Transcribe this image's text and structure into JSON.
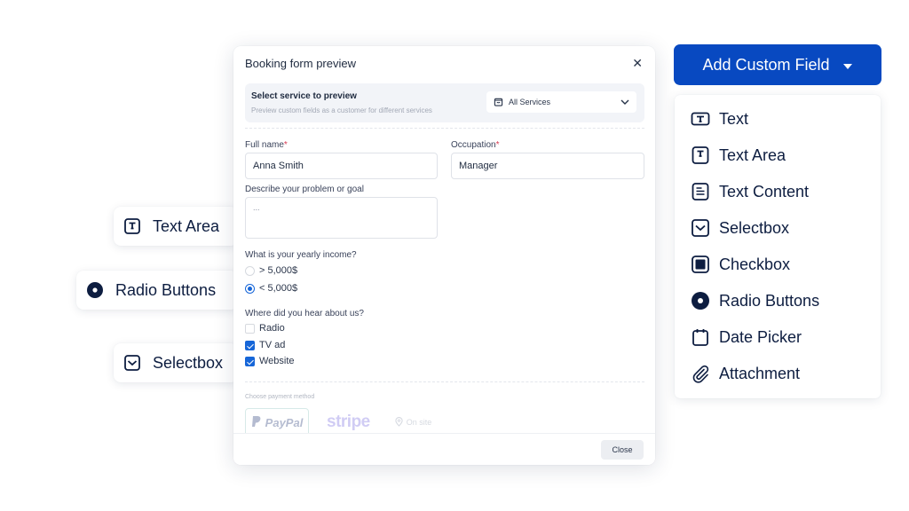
{
  "left_chips": [
    {
      "label": "Text Area",
      "icon": "text-area-icon"
    },
    {
      "label": "Radio Buttons",
      "icon": "radio-button-icon"
    },
    {
      "label": "Selectbox",
      "icon": "selectbox-icon"
    }
  ],
  "modal": {
    "title": "Booking form preview",
    "close_icon": "close-icon",
    "service_panel": {
      "title": "Select service to preview",
      "subtitle": "Preview custom fields as a customer for different services",
      "select_value": "All Services",
      "select_icon": "shopping-bag-icon"
    },
    "fields": {
      "full_name": {
        "label": "Full name",
        "required": "*",
        "value": "Anna Smith"
      },
      "occupation": {
        "label": "Occupation",
        "required": "*",
        "value": "Manager"
      },
      "describe": {
        "label": "Describe your problem or goal",
        "value": "..."
      },
      "income": {
        "label": "What is your yearly income?",
        "options": [
          {
            "label": "> 5,000$",
            "selected": false
          },
          {
            "label": "< 5,000$",
            "selected": true
          }
        ]
      },
      "heard": {
        "label": "Where did you hear about us?",
        "options": [
          {
            "label": "Radio",
            "checked": false
          },
          {
            "label": "TV ad",
            "checked": true
          },
          {
            "label": "Website",
            "checked": true
          }
        ]
      }
    },
    "payment": {
      "label": "Choose payment method",
      "methods": [
        "PayPal",
        "stripe",
        "On site"
      ]
    },
    "close_button": "Close"
  },
  "add_custom_field": {
    "button_label": "Add Custom Field",
    "brand_color": "#0849c1",
    "items": [
      {
        "label": "Text",
        "icon": "text-icon"
      },
      {
        "label": "Text Area",
        "icon": "text-area-icon"
      },
      {
        "label": "Text Content",
        "icon": "text-content-icon"
      },
      {
        "label": "Selectbox",
        "icon": "selectbox-icon"
      },
      {
        "label": "Checkbox",
        "icon": "checkbox-icon"
      },
      {
        "label": "Radio Buttons",
        "icon": "radio-button-icon"
      },
      {
        "label": "Date Picker",
        "icon": "calendar-icon"
      },
      {
        "label": "Attachment",
        "icon": "paperclip-icon"
      }
    ]
  }
}
